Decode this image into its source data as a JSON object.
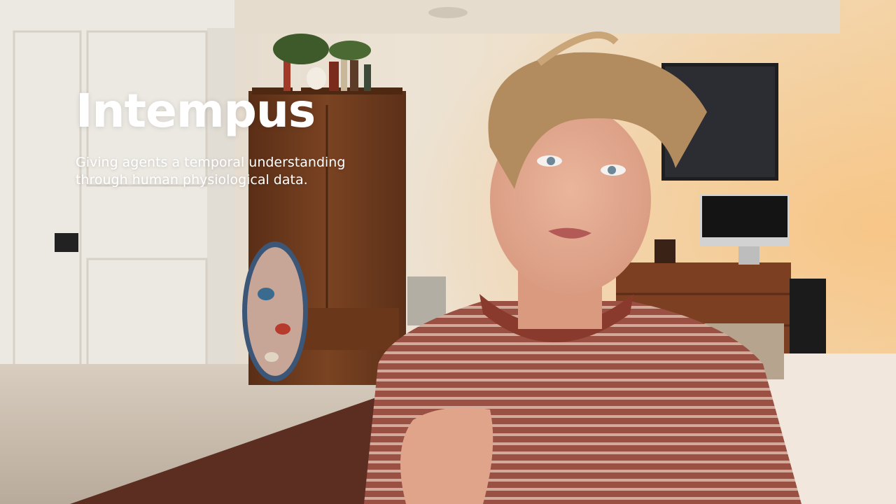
{
  "overlay": {
    "title": "Intempus",
    "subtitle_line1": "Giving agents a temporal understanding",
    "subtitle_line2": "through human physiological data."
  },
  "colors": {
    "overlay_text": "#ffffff",
    "wall": "#efe4d4",
    "wardrobe": "#6b3a1c",
    "sweater_base": "#9a5042",
    "sweater_stripe": "#d3a99a",
    "hair": "#b28c5e",
    "skin": "#e0a88f"
  }
}
